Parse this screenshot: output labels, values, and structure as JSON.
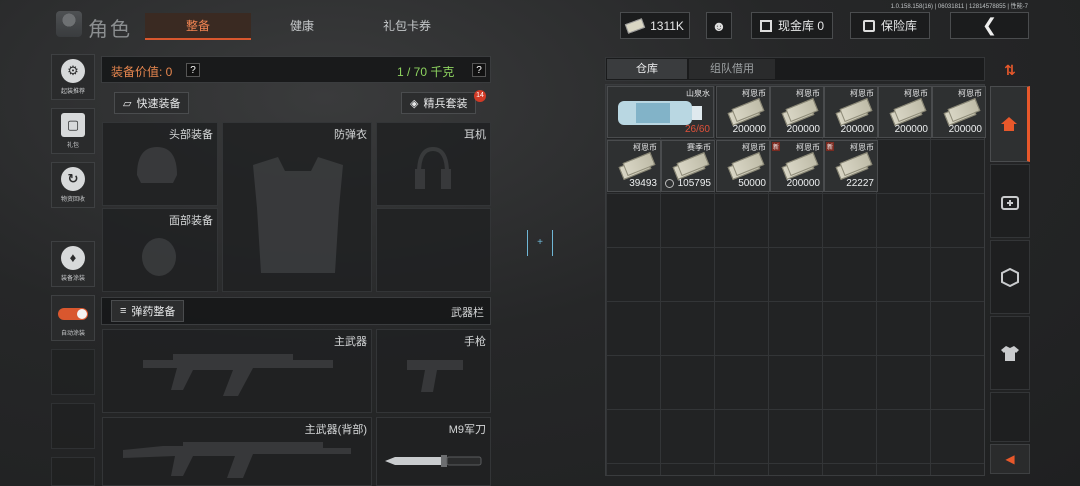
{
  "version_text": "1.0.158.158(16) | 06031811 | 12814578855 | 性能-7",
  "header": {
    "title": "角色",
    "tabs": [
      {
        "label": "整备",
        "active": true
      },
      {
        "label": "健康",
        "active": false
      },
      {
        "label": "礼包卡券",
        "active": false
      }
    ],
    "currency": "1311K",
    "cash_vault": "现金库 0",
    "insurance": "保险库"
  },
  "left_rail": [
    {
      "label": "起装推荐",
      "icon": "helmet-recommend-icon"
    },
    {
      "label": "礼包",
      "icon": "gift-icon"
    },
    {
      "label": "物资回收",
      "icon": "recycle-icon"
    },
    {
      "label": "装备涂装",
      "icon": "paint-icon"
    },
    {
      "label": "自动涂装",
      "icon": "toggle-icon"
    }
  ],
  "equipment": {
    "value_label": "装备价值: 0",
    "weight_label": "1 / 70 千克",
    "quick_equip": "快速装备",
    "elite_kit": "精兵套装",
    "elite_badge": "14",
    "slots": {
      "helmet": "头部装备",
      "armor": "防弹衣",
      "headset": "耳机",
      "face": "面部装备"
    },
    "ammo_button": "弹药整备",
    "weapons_title": "武器栏",
    "weapon_slots": {
      "primary": "主武器",
      "pistol": "手枪",
      "primary_back": "主武器(背部)",
      "knife": "M9军刀"
    }
  },
  "center_marker": "+",
  "inventory": {
    "tabs": [
      {
        "label": "仓库",
        "active": true
      },
      {
        "label": "组队借用",
        "active": false
      }
    ],
    "items": [
      {
        "name": "山泉水",
        "count": "26/60",
        "type": "water"
      },
      {
        "name": "柯恩币",
        "count": "200000",
        "type": "cash",
        "new": false
      },
      {
        "name": "柯恩币",
        "count": "200000",
        "type": "cash",
        "new": false
      },
      {
        "name": "柯恩币",
        "count": "200000",
        "type": "cash",
        "new": false
      },
      {
        "name": "柯恩币",
        "count": "200000",
        "type": "cash",
        "new": false
      },
      {
        "name": "柯恩币",
        "count": "200000",
        "type": "cash",
        "new": false
      },
      {
        "name": "柯恩币",
        "count": "39493",
        "type": "cash",
        "new": false
      },
      {
        "name": "赛季币",
        "count": "105795",
        "type": "season",
        "new": false
      },
      {
        "name": "柯恩币",
        "count": "50000",
        "type": "cash",
        "new": false
      },
      {
        "name": "柯恩币",
        "count": "200000",
        "type": "cash",
        "new": true
      },
      {
        "name": "柯恩币",
        "count": "22227",
        "type": "cash",
        "new": true
      }
    ],
    "new_tag": "新"
  },
  "right_rail": [
    "sort-icon",
    "home-icon",
    "medkit-icon",
    "box-icon",
    "shirt-icon",
    "collapse-arrow-icon"
  ],
  "colors": {
    "accent": "#e8582b",
    "weight_green": "#8dd35f",
    "value_orange": "#e8874f",
    "water_count_red": "#e0513a"
  }
}
